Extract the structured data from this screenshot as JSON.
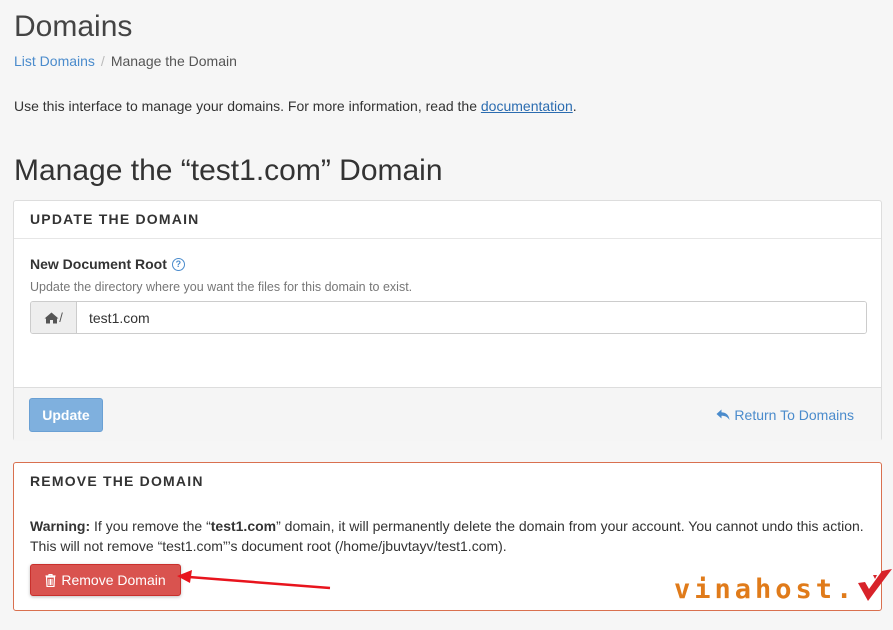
{
  "header": {
    "title": "Domains",
    "breadcrumb": {
      "link": "List Domains",
      "separator": "/",
      "current": "Manage the Domain"
    },
    "intro_text": "Use this interface to manage your domains. For more information, read the",
    "intro_link": "documentation",
    "intro_end": "."
  },
  "main": {
    "title": "Manage the “test1.com” Domain",
    "update_panel": {
      "heading": "UPDATE THE DOMAIN",
      "field_label": "New Document Root",
      "field_help": "Update the directory where you want the files for this domain to exist.",
      "addon_text": "/",
      "input_value": "test1.com",
      "update_button": "Update",
      "return_link": "Return To Domains"
    },
    "remove_panel": {
      "heading": "REMOVE THE DOMAIN",
      "warning_label": "Warning:",
      "warning_part1": " If you remove the “",
      "warning_domain": "test1.com",
      "warning_part2": "” domain, it will permanently delete the domain from your account. You cannot undo this action. This will not remove “test1.com”’s document root (/home/jbuvtayv/test1.com).",
      "remove_button": "Remove Domain"
    }
  },
  "watermark": {
    "text": "vinahost."
  },
  "colors": {
    "link": "#4a8bcc",
    "update_button": "#7fb0de",
    "remove_button": "#d9534f",
    "danger_border": "#d9704f",
    "annotation_arrow": "#e8141d",
    "watermark_orange": "#e07b1a",
    "watermark_red": "#d8232a"
  },
  "icons": {
    "help": "question-circle-icon",
    "home": "home-icon",
    "return": "reply-arrow-icon",
    "trash": "trash-icon"
  }
}
